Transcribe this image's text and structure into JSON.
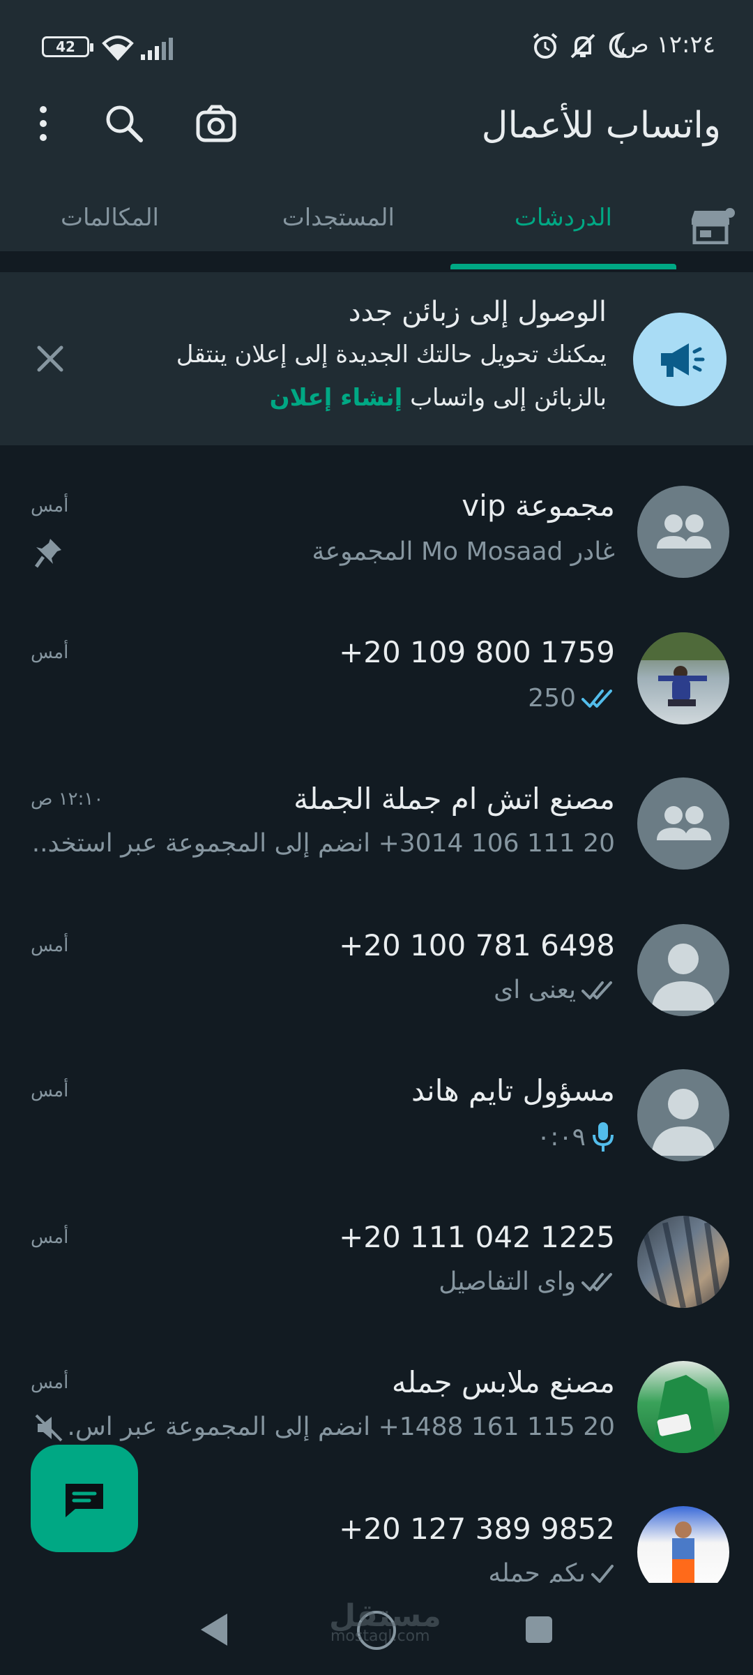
{
  "status_bar": {
    "battery": "42",
    "time": "١٢:٢٤ ص"
  },
  "app_bar": {
    "title": "واتساب للأعمال"
  },
  "tabs": [
    {
      "label": "الدردشات",
      "active": true
    },
    {
      "label": "المستجدات",
      "active": false
    },
    {
      "label": "المكالمات",
      "active": false
    }
  ],
  "promo": {
    "title": "الوصول إلى زبائن جدد",
    "line1": "يمكنك تحويل حالتك الجديدة إلى إعلان ينتقل",
    "line2": "بالزبائن إلى واتساب",
    "link": "إنشاء إعلان"
  },
  "chats": [
    {
      "name": "مجموعة vip",
      "preview": "غادر Mo Mosaad المجموعة",
      "time": "أمس",
      "pinned": true
    },
    {
      "name": "+20 109 800 1759",
      "preview": "250",
      "time": "أمس",
      "ticks": "read"
    },
    {
      "name": "مصنع اتش ام جملة الجملة",
      "preview": "20 111 106 3014+ انضم إلى المجموعة عبر استخد...",
      "time": "١٢:١٠ ص"
    },
    {
      "name": "+20 100 781 6498",
      "preview": "يعنى اى",
      "time": "أمس",
      "ticks": "delivered"
    },
    {
      "name": "مسؤول تايم هاند",
      "preview": "٠:٠٩",
      "time": "أمس",
      "voice": true
    },
    {
      "name": "+20 111 042 1225",
      "preview": "واى التفاصيل",
      "time": "أمس",
      "ticks": "delivered"
    },
    {
      "name": "مصنع ملابس جمله",
      "preview": "20 115 161 1488+ انضم إلى المجموعة عبر اس.",
      "time": "أمس",
      "muted": true
    },
    {
      "name": "+20 127 389 9852",
      "preview": "بكم جمله",
      "time": "",
      "ticks": "sent"
    }
  ],
  "watermark": {
    "main": "مستقل",
    "sub": "mostaql.com"
  },
  "colors": {
    "accent": "#00a884",
    "header_bg": "#202c33",
    "body_bg": "#121b22",
    "read_tick": "#53bdeb"
  }
}
